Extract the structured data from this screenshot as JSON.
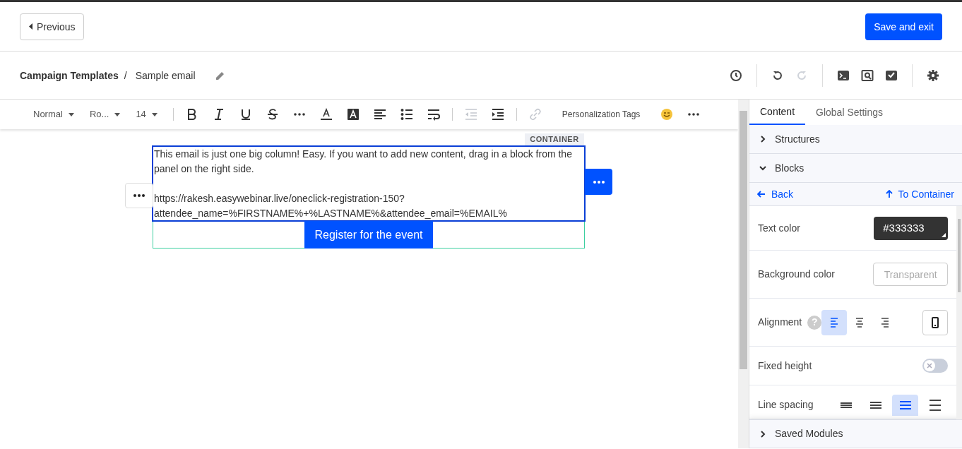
{
  "header": {
    "previous_button": "Previous",
    "save_button": "Save and exit"
  },
  "breadcrumb": {
    "parent": "Campaign Templates",
    "separator": "/",
    "current": "Sample email"
  },
  "top_actions": [
    {
      "kind": "history",
      "disabled": false
    },
    {
      "kind": "undo",
      "disabled": false
    },
    {
      "kind": "redo",
      "disabled": true
    },
    {
      "kind": "code",
      "disabled": false
    },
    {
      "kind": "preview",
      "disabled": false
    },
    {
      "kind": "test",
      "disabled": false
    },
    {
      "kind": "settings",
      "disabled": false
    }
  ],
  "toolbar": [
    {
      "kind": "dropdown",
      "label": "Normal"
    },
    {
      "kind": "dropdown",
      "label": "Ro..."
    },
    {
      "kind": "dropdown",
      "label": "14"
    },
    {
      "kind": "sep"
    },
    {
      "kind": "bold",
      "disabled": false
    },
    {
      "kind": "italic",
      "disabled": false
    },
    {
      "kind": "underline",
      "disabled": false
    },
    {
      "kind": "strike",
      "disabled": false
    },
    {
      "kind": "more",
      "disabled": false
    },
    {
      "kind": "textcolor",
      "disabled": false
    },
    {
      "kind": "bgcolor",
      "disabled": false
    },
    {
      "kind": "align",
      "disabled": false
    },
    {
      "kind": "list",
      "disabled": false
    },
    {
      "kind": "wrap",
      "disabled": false
    },
    {
      "kind": "sep"
    },
    {
      "kind": "outdent",
      "disabled": true
    },
    {
      "kind": "indent",
      "disabled": false
    },
    {
      "kind": "sep"
    },
    {
      "kind": "link",
      "disabled": true
    },
    {
      "kind": "text",
      "label": "Personalization Tags"
    },
    {
      "kind": "emoji"
    },
    {
      "kind": "more",
      "disabled": false
    }
  ],
  "canvas": {
    "container_label": "CONTAINER",
    "paragraph": "This email is just one big column! Easy. If you want to add new content, drag in a block from the panel on the right side.",
    "url_line_1": "https://rakesh.easywebinar.live/oneclick-registration-150?",
    "url_line_2": "attendee_name=%FIRSTNAME%+%LASTNAME%&attendee_email=%EMAIL%",
    "cta_button": "Register for the event"
  },
  "panel": {
    "tabs": [
      {
        "label": "Content",
        "selected": true
      },
      {
        "label": "Global Settings",
        "selected": false
      }
    ],
    "sections": [
      {
        "label": "Structures",
        "expanded": false
      },
      {
        "label": "Blocks",
        "expanded": true
      }
    ],
    "back_link": "Back",
    "container_link": "To Container",
    "text_color": {
      "label": "Text color",
      "value": "#333333"
    },
    "background_color": {
      "label": "Background color",
      "placeholder": "Transparent"
    },
    "alignment": {
      "label": "Alignment",
      "help": "?",
      "options": [
        {
          "kind": "left",
          "selected": true
        },
        {
          "kind": "center",
          "selected": false
        },
        {
          "kind": "right",
          "selected": false
        }
      ]
    },
    "fixed_height": {
      "label": "Fixed height",
      "on": false
    },
    "line_spacing": {
      "label": "Line spacing",
      "options": [
        {
          "kind": "tight",
          "selected": false
        },
        {
          "kind": "normal",
          "selected": false
        },
        {
          "kind": "relaxed",
          "selected": true
        },
        {
          "kind": "loose",
          "selected": false
        }
      ]
    },
    "saved_modules": {
      "label": "Saved Modules",
      "expanded": false
    }
  }
}
